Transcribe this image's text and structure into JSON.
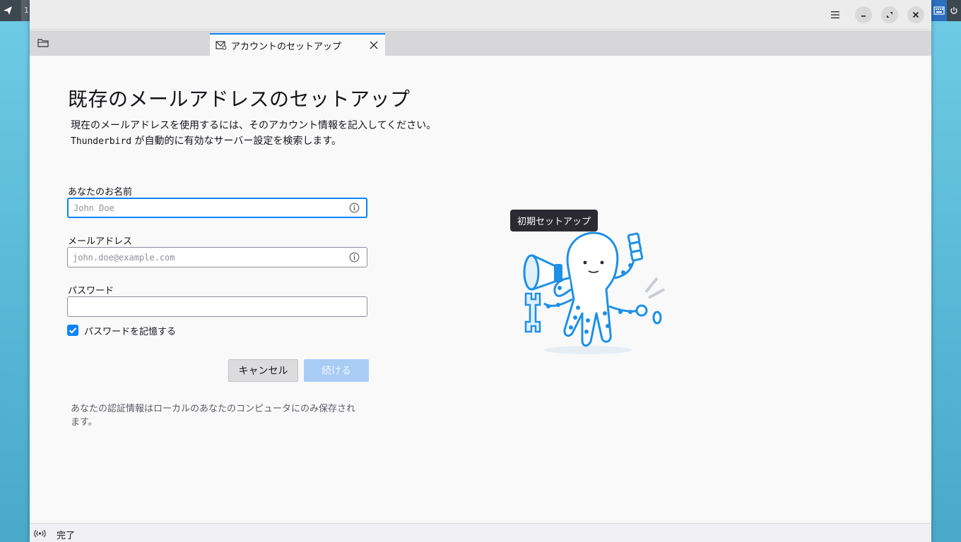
{
  "window": {
    "tab_label": "アカウントのセットアップ"
  },
  "taskbar": {
    "workspace_label": "1"
  },
  "page": {
    "title": "既存のメールアドレスのセットアップ",
    "description_line1": "現在のメールアドレスを使用するには、そのアカウント情報を記入してください。",
    "description_line2_app": "Thunderbird",
    "description_line2_rest": " が自動的に有効なサーバー設定を検索します。"
  },
  "form": {
    "name_label": "あなたのお名前",
    "name_placeholder": "John Doe",
    "name_value": "",
    "email_label": "メールアドレス",
    "email_placeholder": "john.doe@example.com",
    "email_value": "",
    "password_label": "パスワード",
    "password_value": "",
    "remember_password_label": "パスワードを記憶する",
    "remember_password_checked": true,
    "cancel_label": "キャンセル",
    "continue_label": "続ける",
    "note_line1": "あなたの認証情報はローカルのあなたのコンピュータにのみ保存され",
    "note_line2": "ます。"
  },
  "illustration": {
    "tooltip": "初期セットアップ"
  },
  "statusbar": {
    "status_text": "完了"
  },
  "colors": {
    "accent": "#0a84ff",
    "button_disabled": "#a8ccf4",
    "octopus_stroke": "#1e90e6"
  }
}
